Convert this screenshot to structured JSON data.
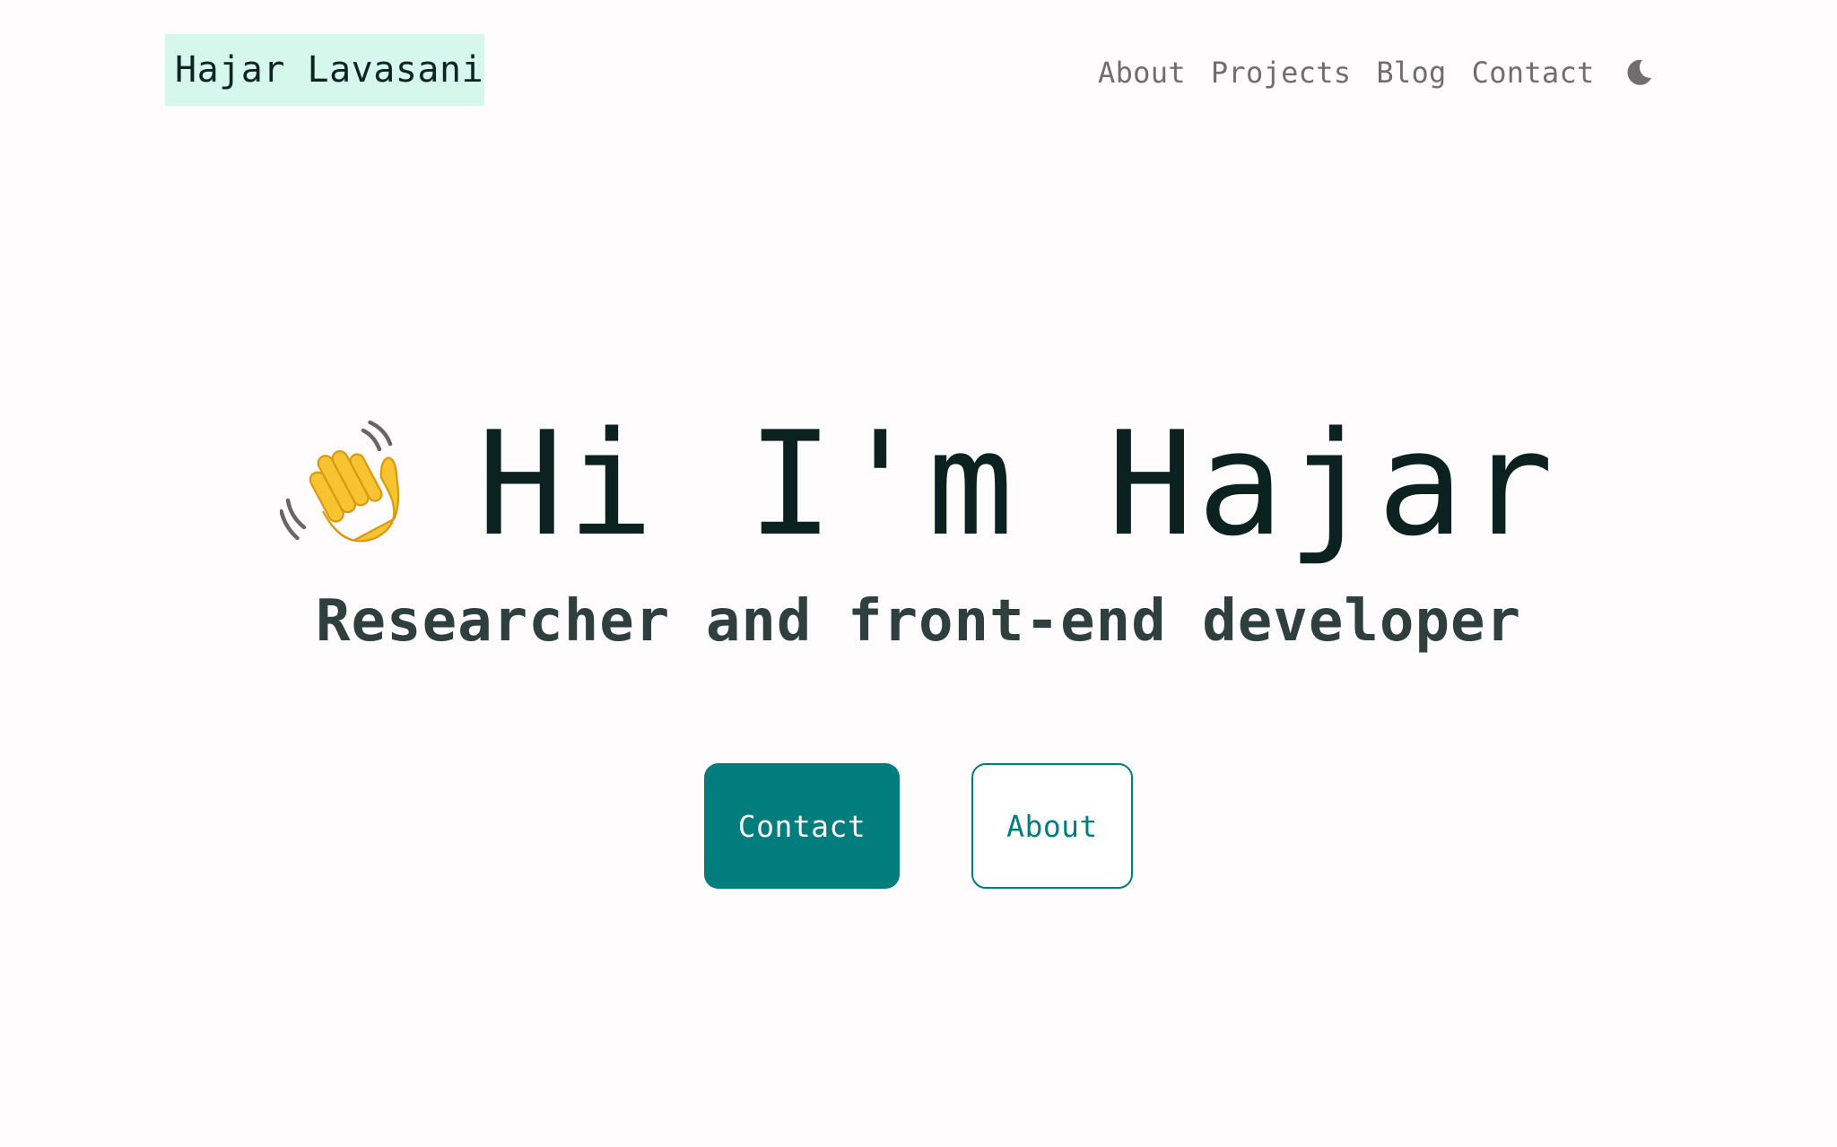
{
  "header": {
    "logo_text": "Hajar Lavasani",
    "nav": [
      {
        "label": "About"
      },
      {
        "label": "Projects"
      },
      {
        "label": "Blog"
      },
      {
        "label": "Contact"
      }
    ],
    "theme_toggle_icon": "moon-icon"
  },
  "hero": {
    "emoji_icon": "waving-hand-icon",
    "headline": "Hi I'm Hajar",
    "subtitle": "Researcher and front-end developer",
    "primary_button": "Contact",
    "secondary_button": "About"
  },
  "colors": {
    "background": "#fefcfc",
    "accent": "#007d7c",
    "logo_highlight": "#d6f7ec",
    "nav_text": "#6e6e6e",
    "headline_text": "#0b2220"
  }
}
